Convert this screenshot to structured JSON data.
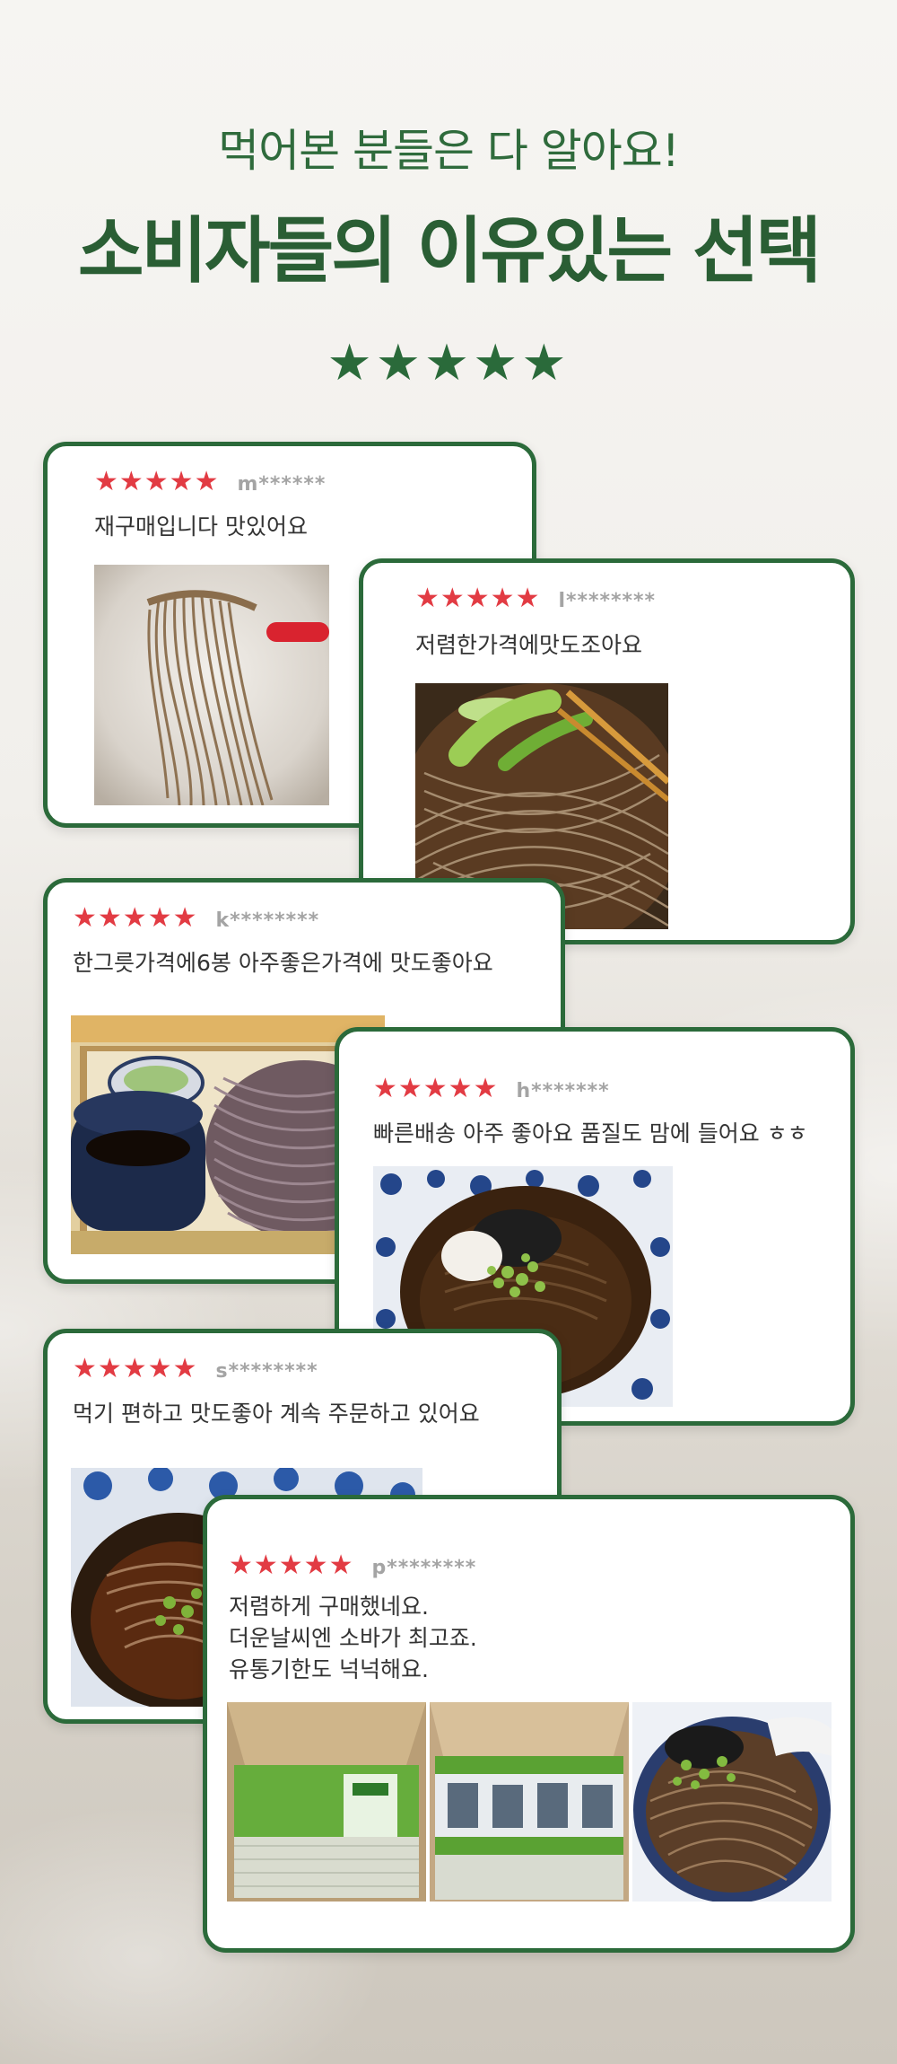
{
  "header": {
    "subtitle": "먹어본 분들은 다 알아요!",
    "title": "소비자들의 이유있는 선택",
    "stars": "★★★★★"
  },
  "colors": {
    "brand_green": "#2b6a3a",
    "star_red": "#e23b43",
    "background": "#f3f1ed"
  },
  "reviews": [
    {
      "stars": "★★★★★",
      "user": "m******",
      "text": "재구매입니다 맛있어요"
    },
    {
      "stars": "★★★★★",
      "user": "l********",
      "text": "저렴한가격에맛도조아요"
    },
    {
      "stars": "★★★★★",
      "user": "k********",
      "text": "한그릇가격에6봉 아주좋은가격에 맛도좋아요"
    },
    {
      "stars": "★★★★★",
      "user": "h*******",
      "text": "빠른배송 아주 좋아요 품질도 맘에 들어요 ㅎㅎ"
    },
    {
      "stars": "★★★★★",
      "user": "s********",
      "text": "먹기 편하고 맛도좋아 계속 주문하고 있어요"
    },
    {
      "stars": "★★★★★",
      "user": "p********",
      "lines": [
        "저렴하게 구매했네요.",
        "더운날씨엔 소바가 최고죠.",
        "유통기한도 넉넉해요."
      ]
    }
  ]
}
